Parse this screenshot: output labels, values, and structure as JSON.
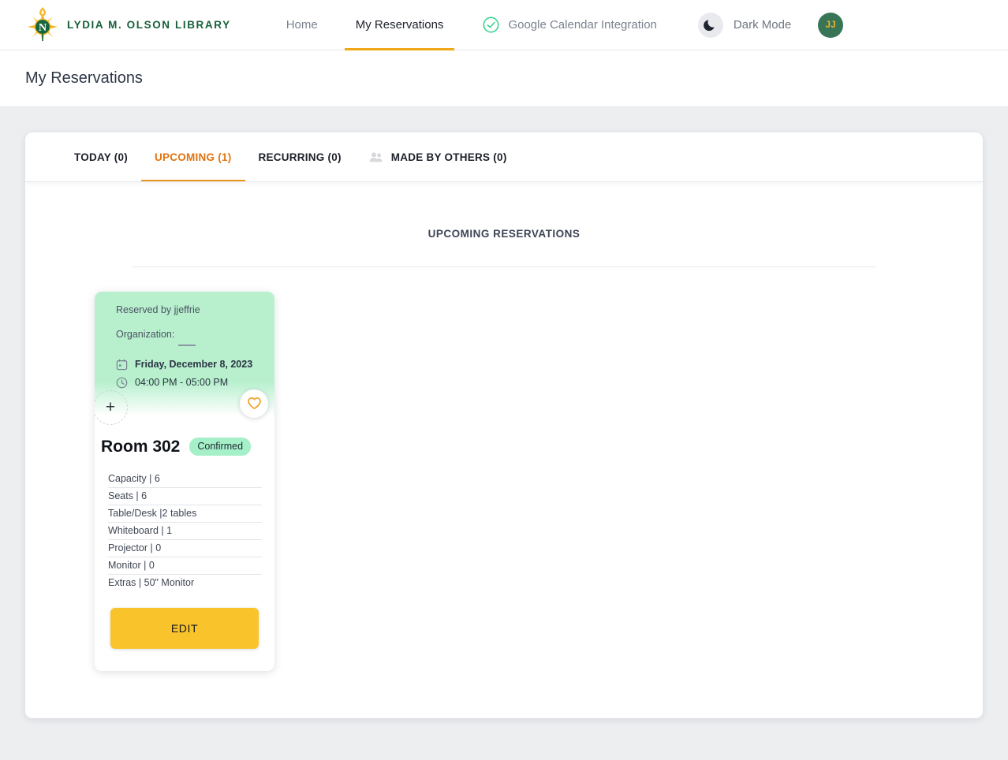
{
  "brand": {
    "name": "LYDIA M. OLSON LIBRARY",
    "logo_icon": "nmu-compass-logo"
  },
  "nav": {
    "links": [
      {
        "label": "Home",
        "icon": null,
        "active": false
      },
      {
        "label": "My Reservations",
        "icon": null,
        "active": true
      },
      {
        "label": "Google Calendar Integration",
        "icon": "check-circle-icon",
        "active": false
      }
    ],
    "dark_mode": {
      "label": "Dark Mode",
      "icon": "moon-icon"
    },
    "avatar": {
      "initials": "JJ"
    }
  },
  "page": {
    "title": "My Reservations"
  },
  "tabs": [
    {
      "label": "TODAY (0)",
      "icon": null,
      "active": false
    },
    {
      "label": "UPCOMING (1)",
      "icon": null,
      "active": true
    },
    {
      "label": "RECURRING (0)",
      "icon": null,
      "active": false
    },
    {
      "label": "MADE BY OTHERS (0)",
      "icon": "people-icon",
      "active": false
    }
  ],
  "main": {
    "section_title": "UPCOMING RESERVATIONS"
  },
  "reservation": {
    "reserved_by": "Reserved by jjeffrie",
    "organization_label": "Organization:",
    "organization_value": "—",
    "date": "Friday, December 8, 2023",
    "time": "04:00 PM - 05:00 PM",
    "date_icon": "calendar-icon",
    "time_icon": "clock-icon",
    "add_icon": "plus-icon",
    "favorite_icon": "heart-icon",
    "room_name": "Room 302",
    "status": "Confirmed",
    "specs": [
      "Capacity | 6",
      "Seats | 6",
      "Table/Desk |2 tables",
      "Whiteboard | 1",
      "Projector | 0",
      "Monitor | 0",
      "Extras | 50\" Monitor"
    ],
    "edit_label": "EDIT"
  },
  "colors": {
    "brand_green": "#16603a",
    "accent_orange": "#e2730d",
    "tab_underline": "#e8961f",
    "edit_yellow": "#f9c32c",
    "card_green": "#b8f0ce",
    "badge_green": "#a5f0c8",
    "avatar_green": "#377556",
    "avatar_text": "#f0b429",
    "page_bg": "#eceef0"
  }
}
